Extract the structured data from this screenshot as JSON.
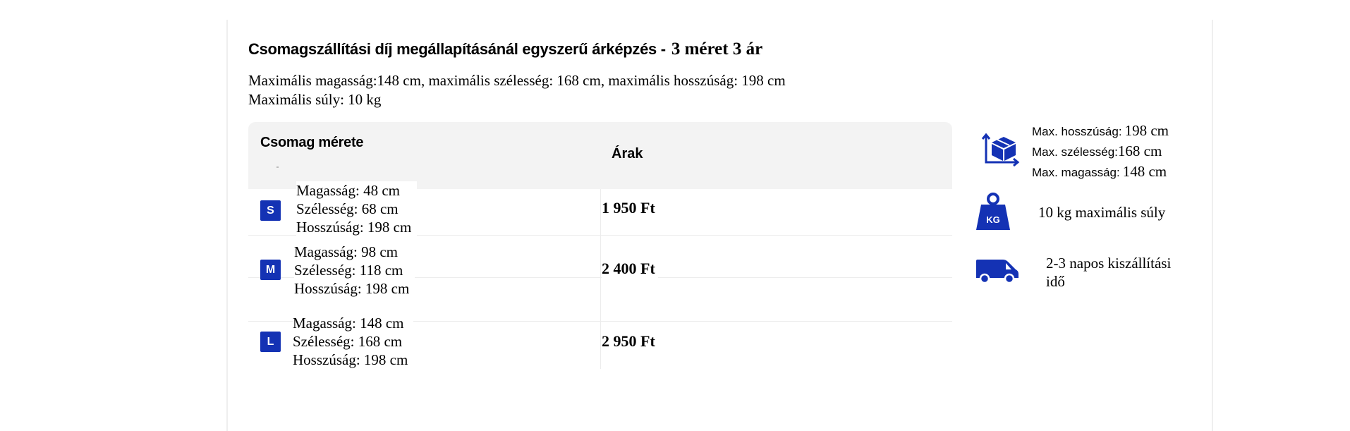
{
  "header": {
    "title_main": "Csomagszállítási díj megállapításánál egyszerű árképzés -",
    "title_tail": "3 méret 3 ár"
  },
  "limits": {
    "line1": "Maximális magasság:148 cm, maximális szélesség: 168 cm, maximális hosszúság: 198 cm",
    "line2": "Maximális súly: 10 kg"
  },
  "table": {
    "col_size": "Csomag mérete",
    "col_price": "Árak",
    "rows": [
      {
        "badge": "S",
        "height": "Magasság: 48 cm",
        "width": "Szélesség: 68 cm",
        "length": "Hosszúság: 198 cm",
        "price": "1 950 Ft"
      },
      {
        "badge": "M",
        "height": "Magasság: 98 cm",
        "width": "Szélesség: 118 cm",
        "length": "Hosszúság: 198 cm",
        "price": "2 400 Ft"
      },
      {
        "badge": "L",
        "height": "Magasság: 148 cm",
        "width": "Szélesség: 168 cm",
        "length": "Hosszúság: 198 cm",
        "price": "2 950 Ft"
      }
    ]
  },
  "side": {
    "dimensions": {
      "length_label": "Max. hosszúság:",
      "length_value": "198 cm",
      "width_label": "Max. szélesség:",
      "width_value": "168 cm",
      "height_label": "Max. magasság:",
      "height_value": "148 cm"
    },
    "weight": {
      "icon_text": "KG",
      "text": "10 kg maximális súly"
    },
    "delivery": {
      "line1": "2-3 napos kiszállítási",
      "line2": "idő"
    }
  },
  "icons": {
    "box": "package-dimensions-icon",
    "weight": "weight-kg-icon",
    "delivery": "delivery-van-icon"
  },
  "colors": {
    "accent": "#1432b4",
    "header_bg": "#f3f3f3"
  }
}
